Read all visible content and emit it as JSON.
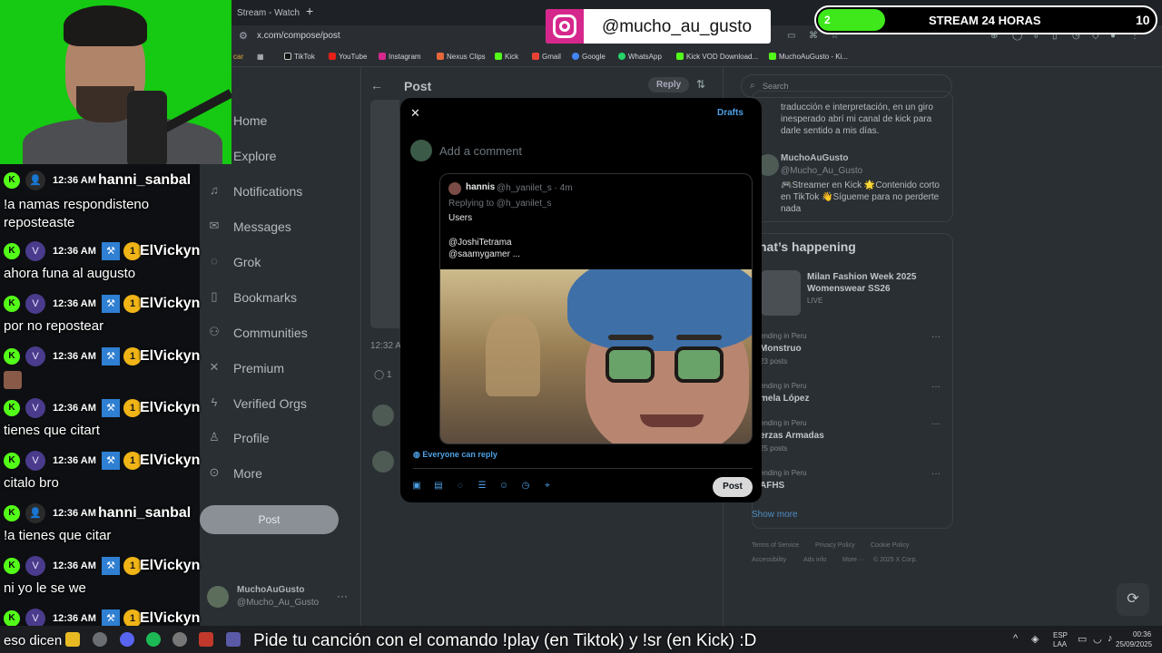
{
  "browser": {
    "tab_title": "Stream - Watch",
    "new_tab": "+",
    "url": "x.com/compose/post",
    "bookmarks": [
      "TikTok",
      "YouTube",
      "Instagram",
      "Nexus Clips",
      "Kick",
      "Gmail",
      "Google",
      "WhatsApp",
      "Kick VOD Download...",
      "MuchoAuGusto - Ki..."
    ],
    "bookmark_prefix": "car"
  },
  "x_nav": {
    "items": [
      "Home",
      "Explore",
      "Notifications",
      "Messages",
      "Grok",
      "Bookmarks",
      "Communities",
      "Premium",
      "Verified Orgs",
      "Profile",
      "More"
    ],
    "post_label": "Post",
    "account_name": "MuchoAuGusto",
    "account_handle": "@Mucho_Au_Gusto",
    "account_more": "···"
  },
  "middle": {
    "header_title": "Post",
    "reply_label": "Reply",
    "time": "12:32 A",
    "comments": "1"
  },
  "right": {
    "search_placeholder": "Search",
    "bio_snippet": "traducción e interpretación, en un giro inesperado abrí mi canal de kick para darle sentido a mis días.",
    "profile_name": "MuchoAuGusto",
    "profile_handle": "@Mucho_Au_Gusto",
    "profile_bio": "🎮Streamer en Kick 🌟Contenido corto en TikTok 👋Sígueme para no perderte nada",
    "happening_title": "hat’s happening",
    "event_title": "Milan Fashion Week 2025 Womenswear SS26",
    "event_status": "LIVE",
    "trends": [
      {
        "category": "ending in Peru",
        "name": "Monstruo",
        "count": "23 posts"
      },
      {
        "category": "ending in Peru",
        "name": "mela López",
        "count": ""
      },
      {
        "category": "ending in Peru",
        "name": "erzas Armadas",
        "count": "25 posts"
      },
      {
        "category": "ending in Peru",
        "name": "AFHS",
        "count": ""
      }
    ],
    "show_more": "Show more",
    "footer": [
      "Terms of Service",
      "Privacy Policy",
      "Cookie Policy",
      "Accessibility",
      "Ads info",
      "More ···",
      "© 2025 X Corp."
    ]
  },
  "modal": {
    "close": "✕",
    "drafts": "Drafts",
    "placeholder": "Add a comment",
    "quote_name": "hannis",
    "quote_meta": "@h_yanilet_s · 4m",
    "quote_replying": "Replying to @h_yanilet_s",
    "quote_lines": [
      "Users",
      "@JoshiTetrama",
      "@saamygamer ..."
    ],
    "everyone_reply": "Everyone can reply",
    "post_label": "Post"
  },
  "overlay": {
    "instagram_handle": "@mucho_au_gusto",
    "stream_goal_current": "2",
    "stream_goal_label": "STREAM 24 HORAS",
    "stream_goal_target": "10",
    "stream_goal_progress": 0.2,
    "marquee": "Pide tu canción con el comando !play (en Tiktok) y !sr (en Kick) :D"
  },
  "chat": [
    {
      "time": "12:36 AM",
      "user": "hanni_sanbal",
      "badge": "👤",
      "mod": false,
      "message": "!a namas respondisteno\nreposteaste"
    },
    {
      "time": "12:36 AM",
      "user": "ElVickyn",
      "badge": "V",
      "mod": true,
      "message": "ahora funa al augusto"
    },
    {
      "time": "12:36 AM",
      "user": "ElVickyn",
      "badge": "V",
      "mod": true,
      "message": "por no repostear"
    },
    {
      "time": "12:36 AM",
      "user": "ElVickyn",
      "badge": "V",
      "mod": true,
      "message": ""
    },
    {
      "time": "12:36 AM",
      "user": "ElVickyn",
      "badge": "V",
      "mod": true,
      "message": "tienes que citart"
    },
    {
      "time": "12:36 AM",
      "user": "ElVickyn",
      "badge": "V",
      "mod": true,
      "message": "citalo bro"
    },
    {
      "time": "12:36 AM",
      "user": "hanni_sanbal",
      "badge": "👤",
      "mod": false,
      "message": "!a tienes que citar"
    },
    {
      "time": "12:36 AM",
      "user": "ElVickyn",
      "badge": "V",
      "mod": true,
      "message": "ni yo le se we"
    },
    {
      "time": "12:36 AM",
      "user": "ElVickyn",
      "badge": "V",
      "mod": true,
      "message": "eso dicen"
    }
  ],
  "chat_kick_badge": "K",
  "chat_sub_badge": "1",
  "taskbar": {
    "lang": "ESP",
    "lang2": "LAA",
    "time": "00:36",
    "date": "25/09/2025",
    "tray_arrow": "^"
  },
  "colors": {
    "kick_green": "#53fc18",
    "x_blue": "#4ea0e5",
    "instagram": "#d6278d"
  }
}
